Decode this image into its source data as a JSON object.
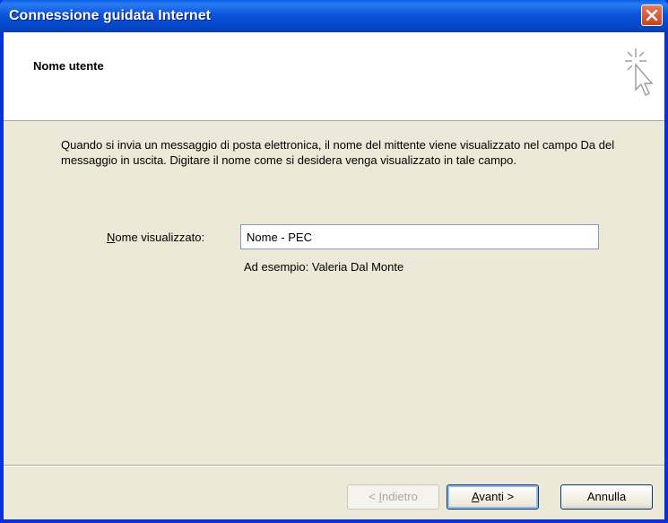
{
  "window": {
    "title": "Connessione guidata Internet"
  },
  "header": {
    "heading": "Nome utente"
  },
  "body": {
    "description": "Quando si invia un messaggio di posta elettronica, il nome del mittente viene visualizzato nel campo Da del messaggio in uscita. Digitare il nome come si desidera venga visualizzato in tale campo.",
    "field_label_first": "N",
    "field_label_rest": "ome visualizzato:",
    "name_value": "Nome - PEC",
    "example": "Ad esempio: Valeria Dal Monte"
  },
  "buttons": {
    "back_prefix": "< ",
    "back_accel": "I",
    "back_rest": "ndietro",
    "next_accel": "A",
    "next_rest": "vanti >",
    "cancel": "Annulla"
  },
  "colors": {
    "titlebar": "#0a54dd",
    "window_bg": "#ece9d8",
    "close_button": "#d4532b"
  },
  "icons": {
    "close": "close-icon",
    "wizard": "wizard-cursor-icon"
  }
}
